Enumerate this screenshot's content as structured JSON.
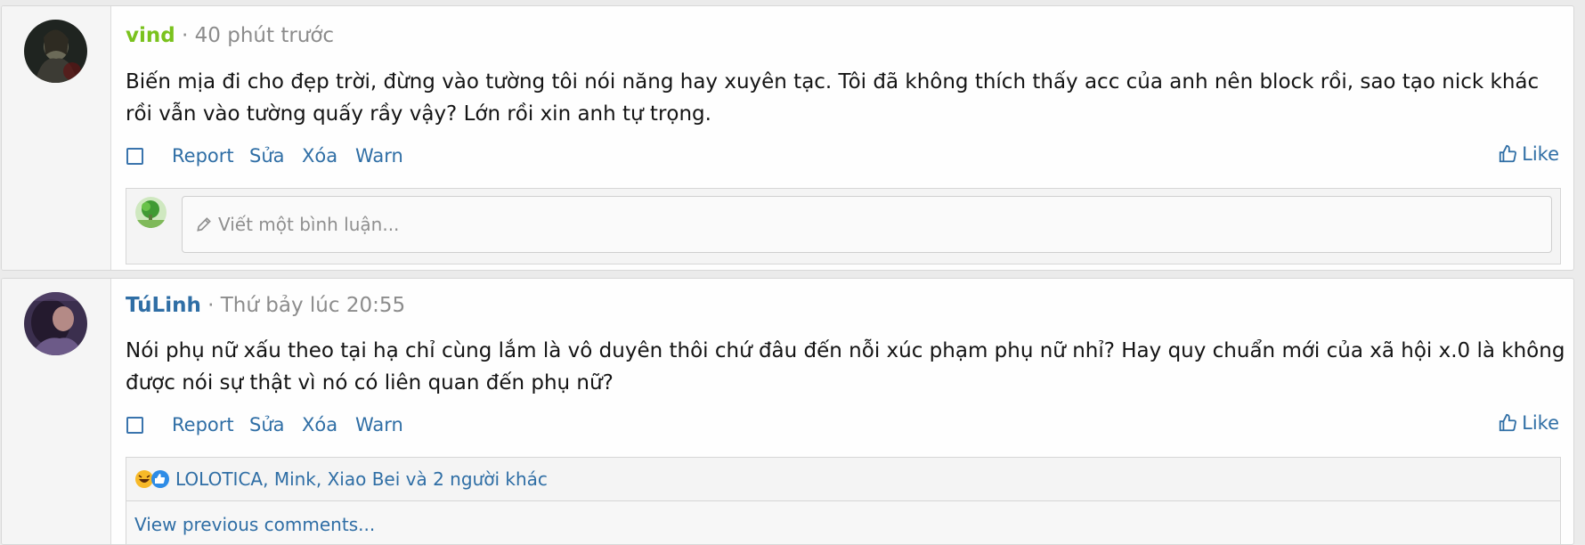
{
  "posts": [
    {
      "author": "vind",
      "author_color": "#7ac21d",
      "time": "· 40 phút trước",
      "text": "Biến mịa đi cho đẹp trời, đừng vào tường tôi nói năng hay xuyên tạc. Tôi đã không thích thấy acc của anh nên block rồi, sao tạo nick khác rồi vẫn vào tường quấy rầy vậy? Lớn rồi xin anh tự trọng.",
      "actions": [
        "Report",
        "Sửa",
        "Xóa",
        "Warn"
      ],
      "like_label": "Like",
      "comment_placeholder": "Viết một bình luận..."
    },
    {
      "author": "TúLinh",
      "author_color": "#2f6ea5",
      "time": "· Thứ bảy lúc 20:55",
      "text": "Nói phụ nữ xấu theo tại hạ chỉ cùng lắm là vô duyên thôi chứ đâu đến nỗi xúc phạm phụ nữ nhỉ? Hay quy chuẩn mới của xã hội x.0 là không được nói sự thật vì nó có liên quan đến phụ nữ?",
      "actions": [
        "Report",
        "Sửa",
        "Xóa",
        "Warn"
      ],
      "like_label": "Like",
      "reactions_text": "LOLOTICA, Mink, Xiao Bei và 2 người khác",
      "view_previous": "View previous comments..."
    }
  ]
}
